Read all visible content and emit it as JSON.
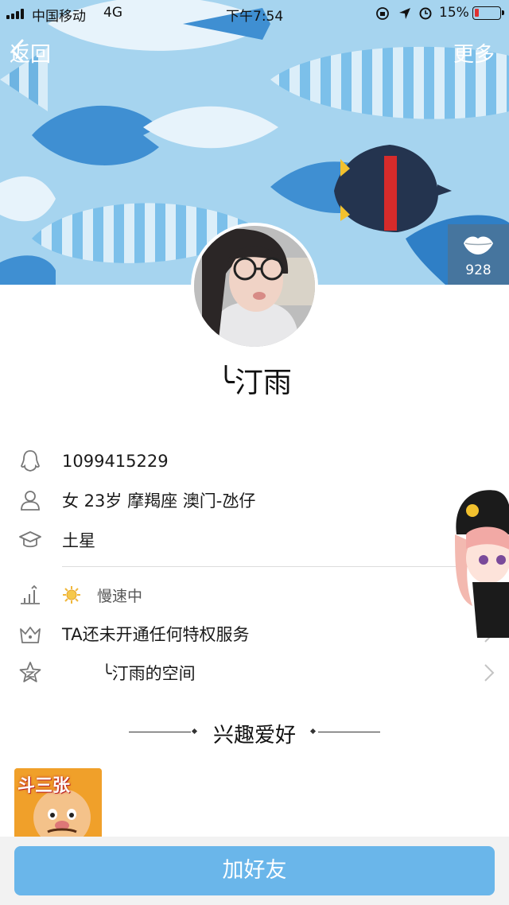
{
  "status_bar": {
    "carrier": "中国移动",
    "network": "4G",
    "time": "下午7:54",
    "battery": "15%"
  },
  "nav": {
    "back_label": "返回",
    "more_label": "更多"
  },
  "like": {
    "count": "928"
  },
  "profile": {
    "nickname": "╰汀雨"
  },
  "info": {
    "qq": "1099415229",
    "personal": "女 23岁 摩羯座 澳门-氹仔",
    "school": "土星",
    "level": "慢速中",
    "privilege": "TA还未开通任何特权服务",
    "space": "╰汀雨的空间"
  },
  "hobby": {
    "title": "兴趣爱好",
    "game_label": "斗三张"
  },
  "action": {
    "add_friend": "加好友"
  },
  "colors": {
    "banner": "#a6d4ef",
    "button": "#6ab6ea",
    "battery_low": "#e03030"
  }
}
